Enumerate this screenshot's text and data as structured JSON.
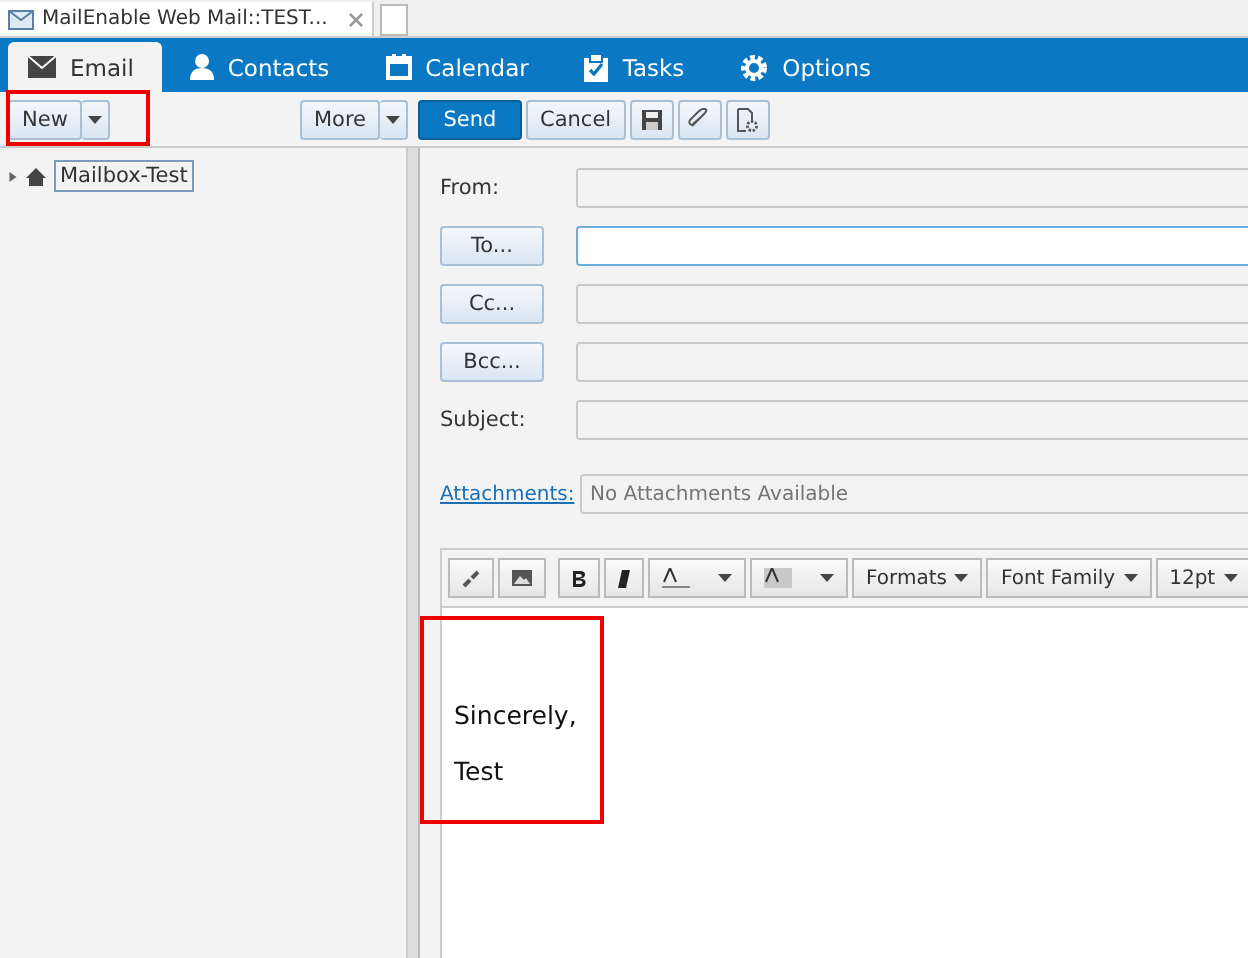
{
  "browser_tab": {
    "title": "MailEnable Web Mail::TEST..."
  },
  "nav_tabs": [
    {
      "label": "Email",
      "kind": "email",
      "selected": true
    },
    {
      "label": "Contacts",
      "kind": "contacts",
      "selected": false
    },
    {
      "label": "Calendar",
      "kind": "calendar",
      "selected": false
    },
    {
      "label": "Tasks",
      "kind": "tasks",
      "selected": false
    },
    {
      "label": "Options",
      "kind": "options",
      "selected": false
    }
  ],
  "toolbar": {
    "new": "New",
    "more": "More",
    "send": "Send",
    "cancel": "Cancel"
  },
  "tree": [
    {
      "label": "Mailbox-Test",
      "expanded": false
    }
  ],
  "form": {
    "from_label": "From:",
    "to": "To...",
    "cc": "Cc...",
    "bcc": "Bcc...",
    "subject_label": "Subject:",
    "attachments_link": "Attachments:",
    "attachments_placeholder": "No Attachments Available"
  },
  "editor_toolbar": {
    "formats": "Formats",
    "font_family": "Font Family",
    "font_size": "12pt"
  },
  "body_lines": [
    "Sincerely,",
    "Test"
  ]
}
